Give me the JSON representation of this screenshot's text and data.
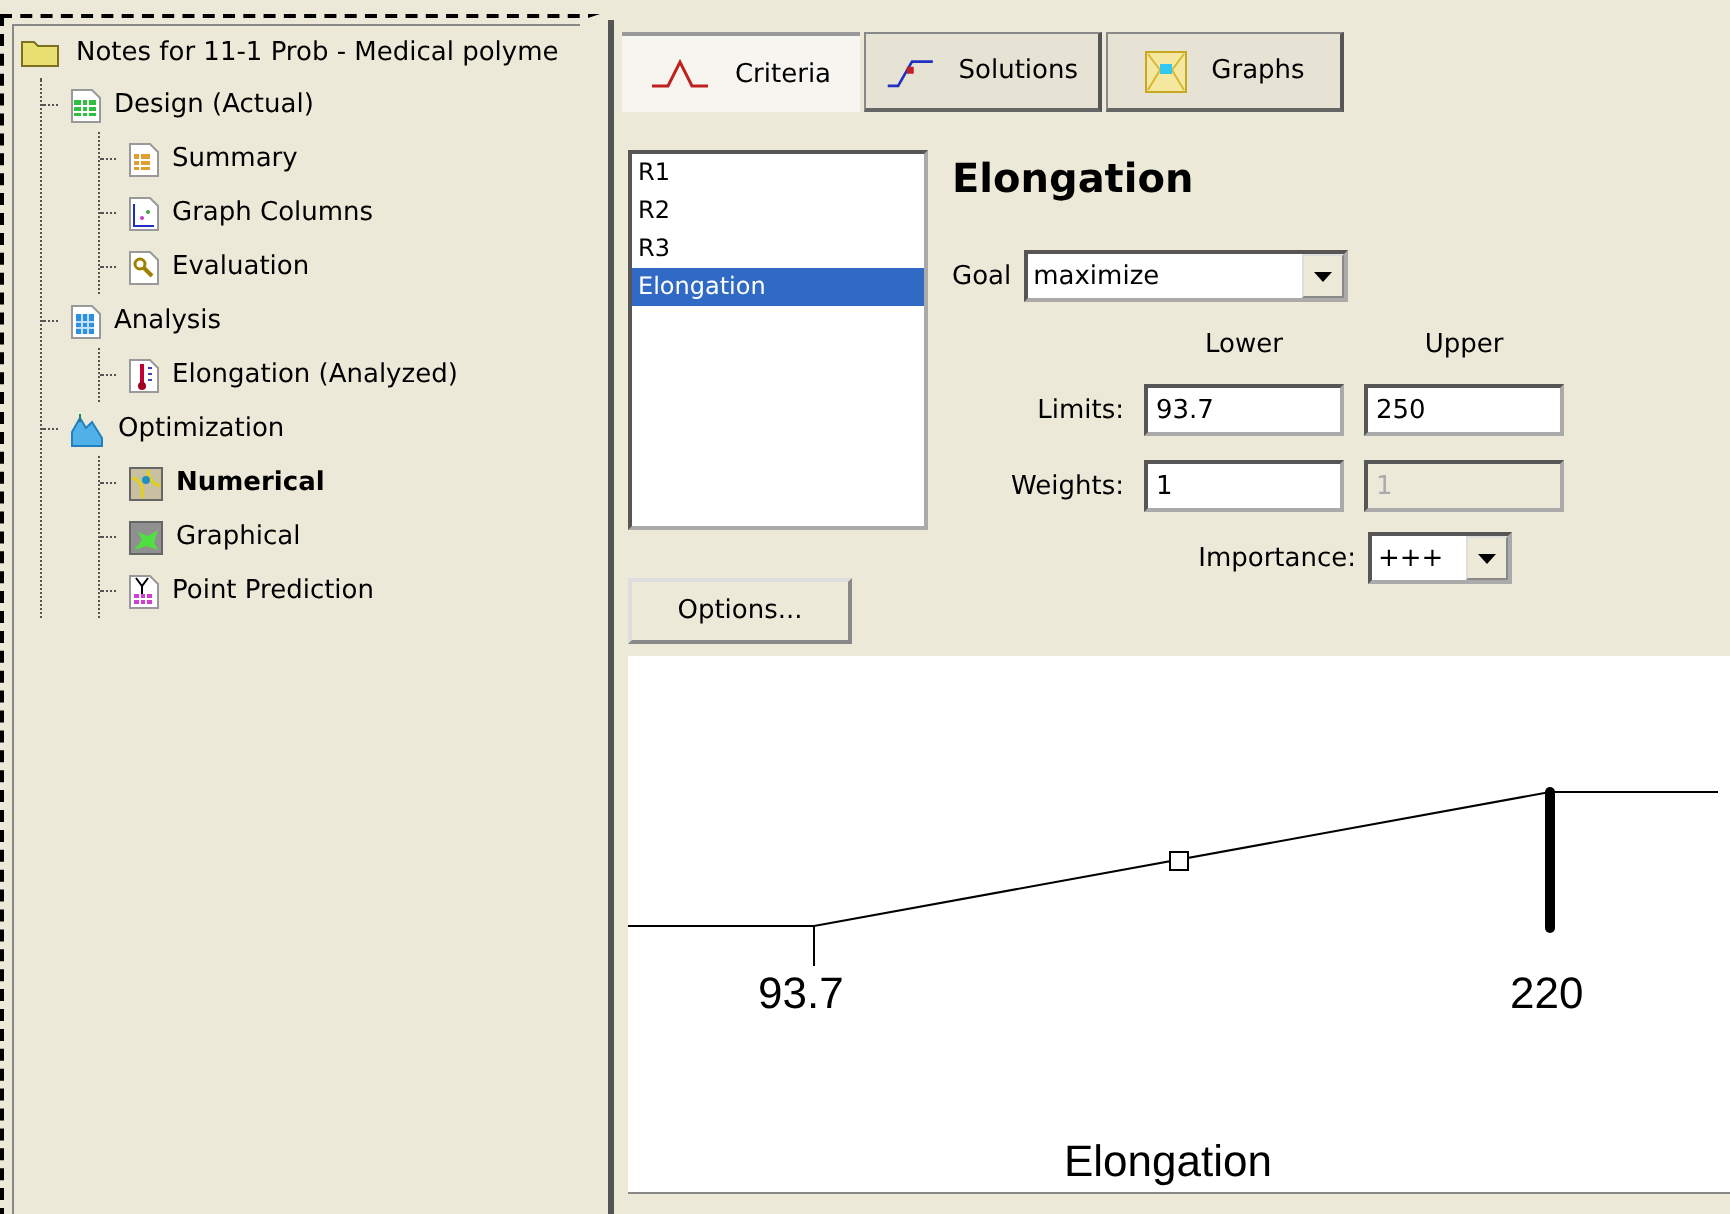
{
  "tree": {
    "label": "Notes for 11-1 Prob - Medical polyme",
    "kind": "folder",
    "selected": false,
    "children": [
      {
        "label": "Design (Actual)",
        "kind": "grid",
        "selected": false,
        "children": [
          {
            "label": "Summary",
            "kind": "summary",
            "selected": false
          },
          {
            "label": "Graph Columns",
            "kind": "scatter",
            "selected": false
          },
          {
            "label": "Evaluation",
            "kind": "magnifier",
            "selected": false
          }
        ]
      },
      {
        "label": "Analysis",
        "kind": "calculator",
        "selected": false,
        "children": [
          {
            "label": "Elongation (Analyzed)",
            "kind": "thermometer",
            "selected": false
          }
        ]
      },
      {
        "label": "Optimization",
        "kind": "mountain",
        "selected": false,
        "children": [
          {
            "label": "Numerical",
            "kind": "numerical",
            "selected": true
          },
          {
            "label": "Graphical",
            "kind": "graphical",
            "selected": false
          },
          {
            "label": "Point Prediction",
            "kind": "prediction",
            "selected": false
          }
        ]
      }
    ]
  },
  "tabs": [
    {
      "label": "Criteria",
      "kind": "peak",
      "selected": true
    },
    {
      "label": "Solutions",
      "kind": "ramp",
      "selected": false
    },
    {
      "label": "Graphs",
      "kind": "map",
      "selected": false
    }
  ],
  "responses": [
    {
      "label": "R1",
      "selected": false
    },
    {
      "label": "R2",
      "selected": false
    },
    {
      "label": "R3",
      "selected": false
    },
    {
      "label": "Elongation",
      "selected": true
    }
  ],
  "criterion": {
    "title": "Elongation",
    "goal_label": "Goal",
    "goal": "maximize",
    "lower_heading": "Lower",
    "upper_heading": "Upper",
    "limits_label": "Limits:",
    "lower_limit": "93.7",
    "upper_limit": "250",
    "weights_label": "Weights:",
    "lower_weight": "1",
    "upper_weight": "1",
    "upper_weight_disabled": true,
    "importance_label": "Importance:",
    "importance": "+++"
  },
  "options_button": "Options...",
  "graph": {
    "low_label": "93.7",
    "high_label": "220",
    "axis_title": "Elongation"
  }
}
